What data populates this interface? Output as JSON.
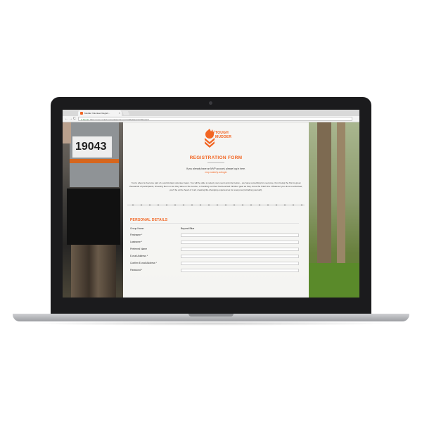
{
  "browser": {
    "tab_title": "Mudder Volunteer Registr...",
    "tab_close": "×",
    "secure_label": "Secure",
    "url": "https://mvp.rosterfy.co/register?group=VolMuddersVOTReward",
    "nav_back": "←",
    "nav_forward": "→",
    "nav_reload": "C"
  },
  "page": {
    "brand_line1": "TOUGH",
    "brand_line2": "MUDDER",
    "bib_number": "19043",
    "form_title": "REGISTRATION FORM",
    "signin_text": "If you already have an MVP account, please log in here.",
    "login_link": "mvp.rosterfy.co/login",
    "intro_text": "You're about to become part of a world-class volunteer team. You will be able to select your event and role below – we have something for everyone, from being the first to greet thousands of participants, cheering them on as they take on the course, or handing out their hard-earned Finisher gear as they cross the finish line. Whatever you do as a volunteer, you'll be at the heart of it all, creating life-changing experiences for everyone (including yourself).",
    "section_title": "PERSONAL DETAILS"
  },
  "form": {
    "group_label": "Group Name",
    "group_value": "Beyond Blue",
    "fields": [
      {
        "label": "Firstname *"
      },
      {
        "label": "Lastname *"
      },
      {
        "label": "Preferred Name"
      },
      {
        "label": "E-mail Address *"
      },
      {
        "label": "Confirm E-mail Address *"
      },
      {
        "label": "Password *"
      }
    ]
  },
  "colors": {
    "accent": "#f26522"
  }
}
